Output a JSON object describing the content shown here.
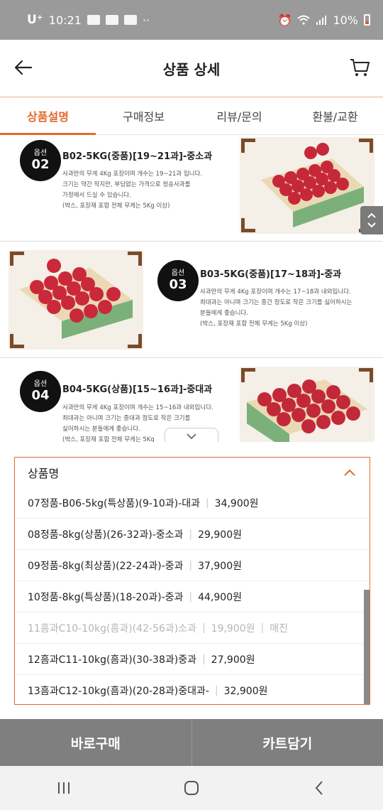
{
  "statusbar": {
    "carrier": "U⁺",
    "time": "10:21",
    "battery": "10%"
  },
  "header": {
    "title": "상품 상세"
  },
  "tabs": [
    {
      "label": "상품설명",
      "active": true
    },
    {
      "label": "구매정보",
      "active": false
    },
    {
      "label": "리뷰/문의",
      "active": false
    },
    {
      "label": "환불/교환",
      "active": false
    }
  ],
  "options_info": [
    {
      "badge_top": "옵션",
      "badge_num": "02",
      "title": "B02-5KG(중품)[19~21과]-중소과",
      "desc": [
        "사과만의 무게 4Kg 포장이며 개수는 19~21과 입니다.",
        "크기는 약간 작지만, 부담없는 가격으로 청송사과를",
        "가정에서 드실 수 있습니다.",
        "(박스, 포장재 포함 전체 무게는 5Kg 이상)"
      ]
    },
    {
      "badge_top": "옵션",
      "badge_num": "03",
      "title": "B03-5KG(중품)[17~18과]-중과",
      "desc": [
        "사과만의 무게 4Kg 포장이며 개수는 17~18과 내외입니다.",
        "최대과는 아니며 크기는 중간 정도로 작은 크기를 싫어하시는",
        "분들에게 좋습니다.",
        "(박스, 포장재 포함 전체 무게는 5Kg 이상)"
      ]
    },
    {
      "badge_top": "옵션",
      "badge_num": "04",
      "title": "B04-5KG(상품)[15~16과]-중대과",
      "desc": [
        "사과만의 무게 4Kg 포장이며 개수는 15~16과 내외입니다.",
        "최대과는 아니며 크기는 중대과 정도로 작은 크기를",
        "싫어하시는 분들에게 좋습니다.",
        "(박스, 포장재 포함 전체 무게는 5Kg"
      ]
    }
  ],
  "select": {
    "label": "상품명",
    "options": [
      {
        "name": "07정품-B06-5kg(특상품)(9-10과)-대과",
        "price": "34,900원",
        "status": ""
      },
      {
        "name": "08정품-8kg(상품)(26-32과)-중소과",
        "price": "29,900원",
        "status": ""
      },
      {
        "name": "09정품-8kg(최상품)(22-24과)-중과",
        "price": "37,900원",
        "status": ""
      },
      {
        "name": "10정품-8kg(특상품)(18-20과)-중과",
        "price": "44,900원",
        "status": ""
      },
      {
        "name": "11흠과C10-10kg(흠과)(42-56과)소과",
        "price": "19,900원",
        "status": "매진"
      },
      {
        "name": "12흠과C11-10kg(흠과)(30-38과)중과",
        "price": "27,900원",
        "status": ""
      },
      {
        "name": "13흠과C12-10kg(흠과)(20-28과)중대과-",
        "price": "32,900원",
        "status": ""
      }
    ]
  },
  "actions": {
    "buy_now": "바로구매",
    "add_cart": "카트담기"
  },
  "colors": {
    "accent": "#e26a2c",
    "button": "#7f7f7f",
    "statusbar": "#9a9a9a"
  }
}
